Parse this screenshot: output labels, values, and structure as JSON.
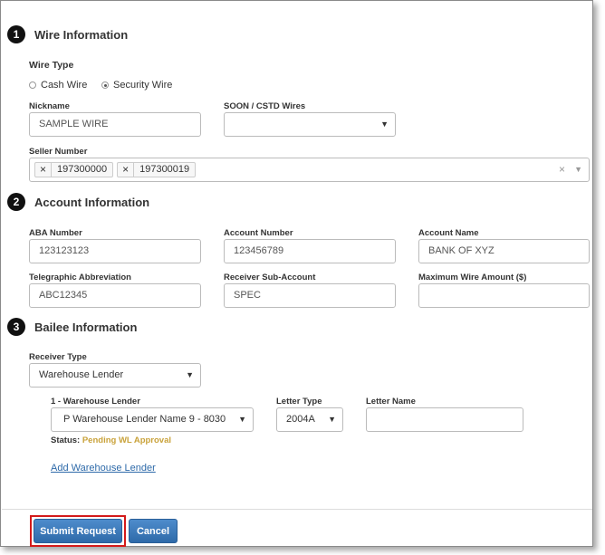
{
  "sections": {
    "wire": {
      "number": "1",
      "title": "Wire Information"
    },
    "account": {
      "number": "2",
      "title": "Account Information"
    },
    "bailee": {
      "number": "3",
      "title": "Bailee Information"
    }
  },
  "wire_info": {
    "wire_type_label": "Wire Type",
    "cash_wire_label": "Cash Wire",
    "security_wire_label": "Security Wire",
    "selected_wire_type": "Security Wire",
    "nickname_label": "Nickname",
    "nickname_value": "SAMPLE WIRE",
    "soon_label": "SOON / CSTD  Wires",
    "soon_value": "",
    "seller_number_label": "Seller Number",
    "seller_numbers": [
      "197300000",
      "197300019"
    ]
  },
  "account_info": {
    "aba_label": "ABA Number",
    "aba_value": "123123123",
    "account_number_label": "Account Number",
    "account_number_value": "123456789",
    "account_name_label": "Account Name",
    "account_name_value": "BANK OF XYZ",
    "telegraphic_label": "Telegraphic Abbreviation",
    "telegraphic_value": "ABC12345",
    "receiver_sub_label": "Receiver Sub-Account",
    "receiver_sub_value": "SPEC",
    "max_wire_label": "Maximum Wire Amount ($)",
    "max_wire_value": ""
  },
  "bailee_info": {
    "receiver_type_label": "Receiver Type",
    "receiver_type_value": "Warehouse Lender",
    "wl_label": "1 - Warehouse Lender",
    "wl_value": "P Warehouse Lender Name 9 - 8030",
    "letter_type_label": "Letter Type",
    "letter_type_value": "2004A",
    "letter_name_label": "Letter Name",
    "letter_name_value": "",
    "status_label": "Status:",
    "status_value": "Pending WL Approval",
    "add_wl_link": "Add Warehouse Lender"
  },
  "actions": {
    "submit_label": "Submit Request",
    "cancel_label": "Cancel"
  },
  "colors": {
    "primary": "#2e6aa9",
    "status_pending": "#c9a23a",
    "highlight": "#d31a1a"
  }
}
